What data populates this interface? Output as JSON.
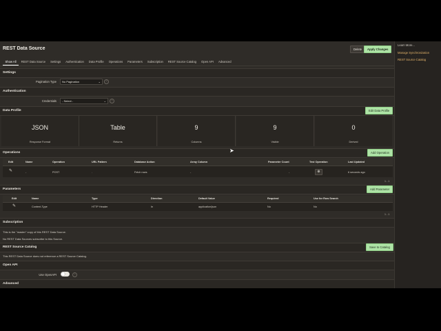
{
  "page": {
    "title": "REST Data Source",
    "delete_label": "Delete",
    "apply_label": "Apply Changes",
    "tabs": [
      "Show All",
      "REST Data Source",
      "Settings",
      "Authentication",
      "Data Profile",
      "Operations",
      "Parameters",
      "Subscription",
      "REST Source Catalog",
      "Open API",
      "Advanced"
    ],
    "active_tab": "Show All"
  },
  "settings": {
    "heading": "Settings",
    "pagination_label": "Pagination Type",
    "pagination_value": "No Pagination"
  },
  "authentication": {
    "heading": "Authentication",
    "credentials_label": "Credentials",
    "credentials_value": "- Select -"
  },
  "data_profile": {
    "heading": "Data Profile",
    "edit_button": "Edit Data Profile",
    "cards": [
      {
        "value": "JSON",
        "caption": "Response Format"
      },
      {
        "value": "Table",
        "caption": "Returns"
      },
      {
        "value": "9",
        "caption": "Columns"
      },
      {
        "value": "9",
        "caption": "Visible"
      },
      {
        "value": "0",
        "caption": "Derived"
      }
    ]
  },
  "operations": {
    "heading": "Operations",
    "add_button": "Add Operation",
    "columns": [
      "Edit",
      "Name",
      "Operation",
      "URL Pattern",
      "Database Action",
      "Array Column",
      "Parameter Count",
      "Test Operation",
      "Last Updated"
    ],
    "row": {
      "name": "-",
      "operation": "POST",
      "url_pattern": ".",
      "database_action": "Fetch rows",
      "array_column": "-",
      "parameter_count": "-",
      "last_updated": "6 seconds ago"
    },
    "pager": "1 - 1"
  },
  "parameters": {
    "heading": "Parameters",
    "add_button": "Add Parameter",
    "columns": [
      "Edit",
      "Name",
      "Type",
      "Direction",
      "Default Value",
      "Required",
      "Use for Row Search"
    ],
    "row": {
      "name": "Content-Type",
      "type": "HTTP Header",
      "direction": "In",
      "default_value": "application/json",
      "required": "No",
      "row_search": "No"
    },
    "pager": "1 - 1"
  },
  "subscription": {
    "heading": "Subscription",
    "note1": "This is the \"master\" copy of this REST Data Source.",
    "note2": "No REST Data Sources subscribe to this Source."
  },
  "catalog": {
    "heading": "REST Source Catalog",
    "save_button": "Save to Catalog",
    "note": "This REST Data Source does not reference a REST Source Catalog."
  },
  "openapi": {
    "heading": "Open API",
    "use_label": "Use OpenAPI"
  },
  "advanced": {
    "heading": "Advanced"
  },
  "sidebar": {
    "links": [
      "Learn More...",
      "Manage Synchronization",
      "REST Source Catalog"
    ]
  }
}
